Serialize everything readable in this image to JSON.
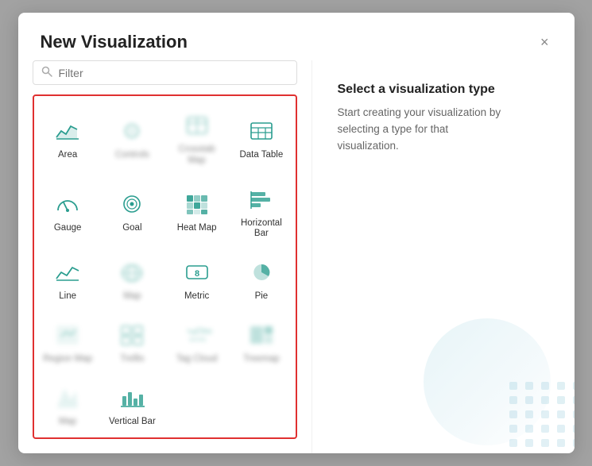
{
  "modal": {
    "title": "New Visualization",
    "close_label": "×"
  },
  "filter": {
    "placeholder": "Filter"
  },
  "right_panel": {
    "title": "Select a visualization type",
    "description": "Start creating your visualization by selecting a type for that visualization."
  },
  "viz_items": [
    {
      "id": "area",
      "label": "Area",
      "blurred": false,
      "icon": "area"
    },
    {
      "id": "controls",
      "label": "Controls",
      "blurred": true,
      "icon": "controls"
    },
    {
      "id": "crosstab",
      "label": "Crosstab Map",
      "blurred": true,
      "icon": "crosstab"
    },
    {
      "id": "data-table",
      "label": "Data Table",
      "blurred": false,
      "icon": "data-table"
    },
    {
      "id": "gauge",
      "label": "Gauge",
      "blurred": false,
      "icon": "gauge"
    },
    {
      "id": "goal",
      "label": "Goal",
      "blurred": false,
      "icon": "goal"
    },
    {
      "id": "heat-map",
      "label": "Heat Map",
      "blurred": false,
      "icon": "heat-map"
    },
    {
      "id": "horizontal-bar",
      "label": "Horizontal Bar",
      "blurred": false,
      "icon": "horizontal-bar"
    },
    {
      "id": "line",
      "label": "Line",
      "blurred": false,
      "icon": "line"
    },
    {
      "id": "map",
      "label": "Map",
      "blurred": true,
      "icon": "map"
    },
    {
      "id": "metric",
      "label": "Metric",
      "blurred": false,
      "icon": "metric"
    },
    {
      "id": "pie",
      "label": "Pie",
      "blurred": false,
      "icon": "pie"
    },
    {
      "id": "region-map",
      "label": "Region Map",
      "blurred": true,
      "icon": "region-map"
    },
    {
      "id": "trellis",
      "label": "Trellis",
      "blurred": true,
      "icon": "trellis"
    },
    {
      "id": "tag-cloud",
      "label": "Tag Cloud",
      "blurred": true,
      "icon": "tag-cloud"
    },
    {
      "id": "treemap",
      "label": "Treemap",
      "blurred": true,
      "icon": "treemap"
    },
    {
      "id": "map2",
      "label": "Map",
      "blurred": true,
      "icon": "map2"
    },
    {
      "id": "vertical-bar",
      "label": "Vertical Bar",
      "blurred": false,
      "icon": "vertical-bar"
    }
  ],
  "colors": {
    "teal": "#2a9d8f",
    "red_border": "#e03030"
  }
}
